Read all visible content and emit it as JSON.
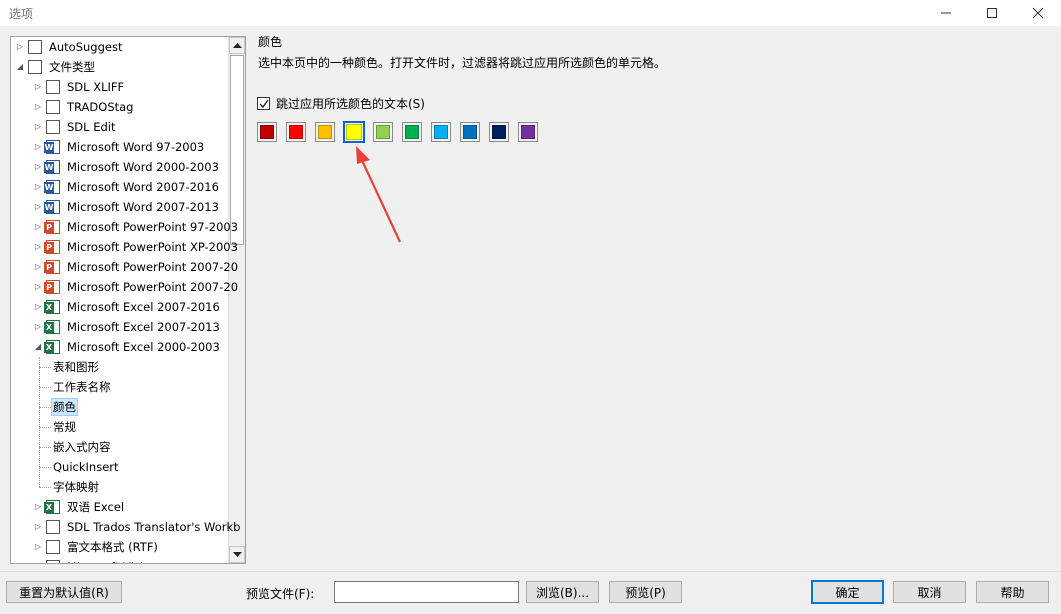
{
  "window": {
    "title": "选项",
    "minimize_icon": "minimize-icon",
    "maximize_icon": "maximize-icon",
    "close_icon": "close-icon"
  },
  "tree": {
    "items": [
      {
        "label": "AutoSuggest",
        "icon": "autosuggest-icon",
        "expander": "collapsed",
        "level": 0
      },
      {
        "label": "文件类型",
        "icon": "gear-icon",
        "expander": "expanded",
        "level": 0
      },
      {
        "label": "SDL XLIFF",
        "icon": "file-icon",
        "expander": "collapsed",
        "level": 1
      },
      {
        "label": "TRADOStag",
        "icon": "tradostag-icon",
        "expander": "collapsed",
        "level": 1
      },
      {
        "label": "SDL Edit",
        "icon": "pencil-icon",
        "expander": "collapsed",
        "level": 1
      },
      {
        "label": "Microsoft Word 97-2003",
        "icon": "word-icon",
        "expander": "collapsed",
        "level": 1
      },
      {
        "label": "Microsoft Word 2000-2003",
        "icon": "word-icon",
        "expander": "collapsed",
        "level": 1
      },
      {
        "label": "Microsoft Word 2007-2016",
        "icon": "word-icon",
        "expander": "collapsed",
        "level": 1
      },
      {
        "label": "Microsoft Word 2007-2013",
        "icon": "word-icon",
        "expander": "collapsed",
        "level": 1
      },
      {
        "label": "Microsoft PowerPoint 97-2003",
        "icon": "powerpoint-icon",
        "expander": "collapsed",
        "level": 1
      },
      {
        "label": "Microsoft PowerPoint XP-2003",
        "icon": "powerpoint-icon",
        "expander": "collapsed",
        "level": 1
      },
      {
        "label": "Microsoft PowerPoint 2007-20",
        "icon": "powerpoint-icon",
        "expander": "collapsed",
        "level": 1
      },
      {
        "label": "Microsoft PowerPoint 2007-20",
        "icon": "powerpoint-icon",
        "expander": "collapsed",
        "level": 1
      },
      {
        "label": "Microsoft Excel 2007-2016",
        "icon": "excel-icon",
        "expander": "collapsed",
        "level": 1
      },
      {
        "label": "Microsoft Excel 2007-2013",
        "icon": "excel-icon",
        "expander": "collapsed",
        "level": 1
      },
      {
        "label": "Microsoft Excel 2000-2003",
        "icon": "excel-icon",
        "expander": "expanded",
        "level": 1
      },
      {
        "label": "表和图形",
        "icon": "",
        "expander": "none",
        "level": 2
      },
      {
        "label": "工作表名称",
        "icon": "",
        "expander": "none",
        "level": 2
      },
      {
        "label": "颜色",
        "icon": "",
        "expander": "none",
        "level": 2,
        "selected": true
      },
      {
        "label": "常规",
        "icon": "",
        "expander": "none",
        "level": 2
      },
      {
        "label": "嵌入式内容",
        "icon": "",
        "expander": "none",
        "level": 2
      },
      {
        "label": "QuickInsert",
        "icon": "",
        "expander": "none",
        "level": 2
      },
      {
        "label": "字体映射",
        "icon": "",
        "expander": "none",
        "level": 2
      },
      {
        "label": "双语 Excel",
        "icon": "excel-icon",
        "expander": "collapsed",
        "level": 1
      },
      {
        "label": "SDL Trados Translator's Workb",
        "icon": "trados-icon",
        "expander": "collapsed",
        "level": 1
      },
      {
        "label": "富文本格式 (RTF)",
        "icon": "rtf-icon",
        "expander": "collapsed",
        "level": 1
      },
      {
        "label": "Microsoft Visio",
        "icon": "visio-icon",
        "expander": "collapsed",
        "level": 1
      }
    ]
  },
  "panel": {
    "heading": "颜色",
    "description": "选中本页中的一种颜色。打开文件时，过滤器将跳过应用所选颜色的单元格。",
    "checkbox": {
      "label": "跳过应用所选颜色的文本(S)",
      "checked": true
    },
    "swatches": [
      {
        "color": "#c00000",
        "name": "dark-red"
      },
      {
        "color": "#ff0000",
        "name": "red"
      },
      {
        "color": "#ffc000",
        "name": "orange"
      },
      {
        "color": "#ffff00",
        "name": "yellow",
        "selected": true
      },
      {
        "color": "#92d050",
        "name": "light-green"
      },
      {
        "color": "#00b050",
        "name": "green"
      },
      {
        "color": "#00b0f0",
        "name": "light-blue"
      },
      {
        "color": "#0070c0",
        "name": "blue"
      },
      {
        "color": "#002060",
        "name": "dark-blue"
      },
      {
        "color": "#7030a0",
        "name": "purple"
      }
    ],
    "annotation_arrow_color": "#e8403a"
  },
  "footer": {
    "reset_label": "重置为默认值(R)",
    "preview_file_label": "预览文件(F):",
    "preview_file_value": "",
    "browse_label": "浏览(B)...",
    "preview_label": "预览(P)",
    "ok_label": "确定",
    "cancel_label": "取消",
    "help_label": "帮助"
  }
}
